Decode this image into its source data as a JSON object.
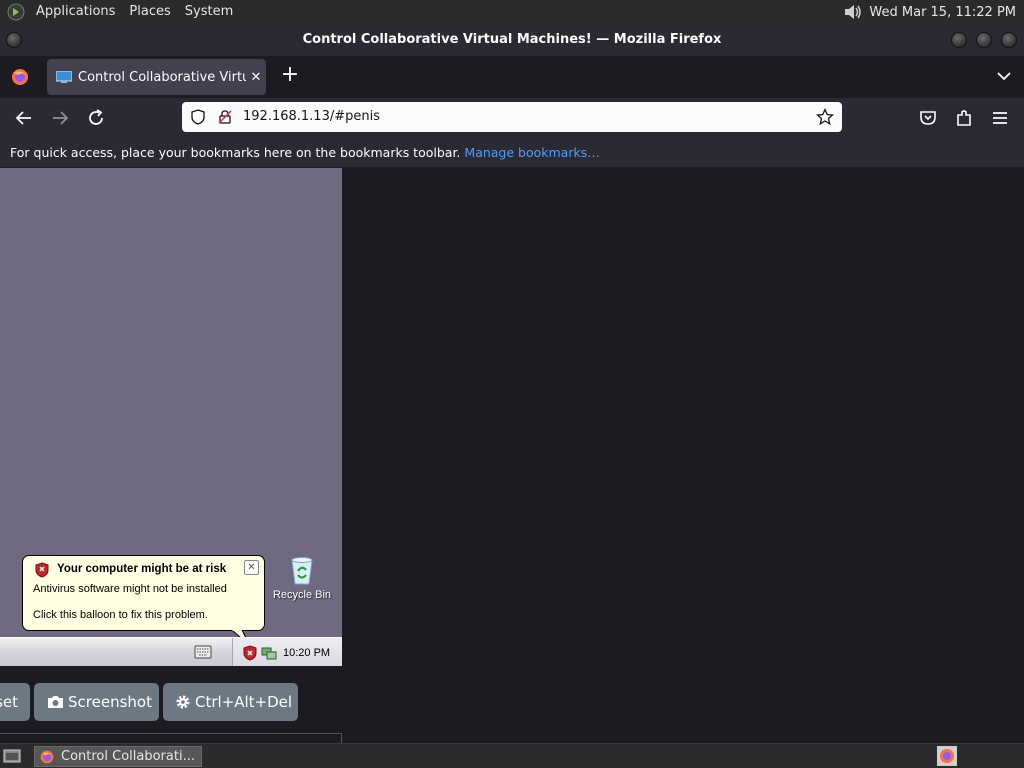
{
  "top_panel": {
    "menus": [
      "Applications",
      "Places",
      "System"
    ],
    "clock": "Wed Mar 15, 11:22 PM",
    "volume_icon": "speaker-icon"
  },
  "window": {
    "title": "Control Collaborative Virtual Machines! — Mozilla Firefox"
  },
  "tab": {
    "title": "Control Collaborative Virtual Machines!",
    "close_label": "✕"
  },
  "urlbar": {
    "url": "192.168.1.13/#penis"
  },
  "bookmarks_toolbar": {
    "message": "For quick access, place your bookmarks here on the bookmarks toolbar.",
    "link": "Manage bookmarks…"
  },
  "vm_screen": {
    "recycle_bin_label": "Recycle Bin",
    "taskbar_time": "10:20 PM",
    "balloon": {
      "title": "Your computer might be at risk",
      "line1": "Antivirus software might not be installed",
      "line2": "Click this balloon to fix this problem."
    }
  },
  "controls": {
    "reset_label": "set",
    "screenshot_label": "Screenshot",
    "ctrl_alt_del_label": "Ctrl+Alt+Del"
  },
  "bottom_panel": {
    "task_label": "Control Collaborati..."
  },
  "colors": {
    "accent_link": "#45a1ff",
    "vm_desktop": "#6f6a80",
    "control_button": "#6c7882"
  }
}
